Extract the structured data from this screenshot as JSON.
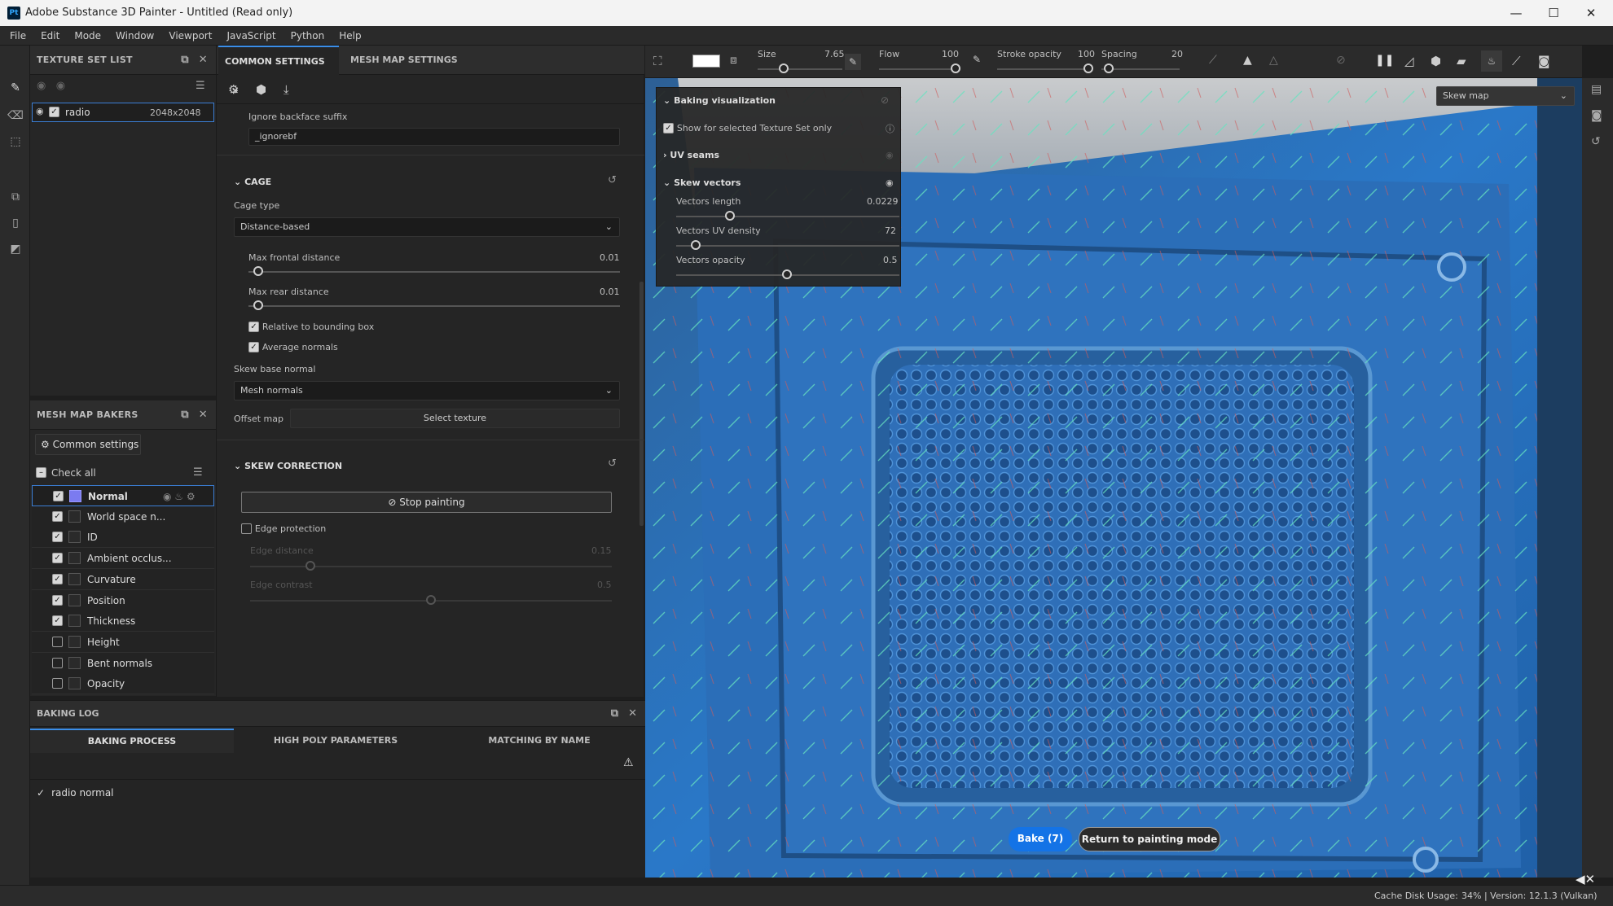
{
  "window": {
    "app_icon": "Pt",
    "title": "Adobe Substance 3D Painter - Untitled (Read only)",
    "minimize": "—",
    "maximize": "☐",
    "close": "✕"
  },
  "menu": [
    "File",
    "Edit",
    "Mode",
    "Window",
    "Viewport",
    "JavaScript",
    "Python",
    "Help"
  ],
  "texture_set_list": {
    "title": "TEXTURE SET LIST",
    "item": {
      "name": "radio",
      "resolution": "2048x2048",
      "checked": true
    }
  },
  "mesh_map_bakers": {
    "title": "MESH MAP BAKERS",
    "common_settings": "Common settings",
    "check_all": "Check all",
    "items": [
      {
        "label": "Normal",
        "checked": true,
        "selected": true
      },
      {
        "label": "World space n...",
        "checked": true
      },
      {
        "label": "ID",
        "checked": true
      },
      {
        "label": "Ambient occlus...",
        "checked": true
      },
      {
        "label": "Curvature",
        "checked": true
      },
      {
        "label": "Position",
        "checked": true
      },
      {
        "label": "Thickness",
        "checked": true
      },
      {
        "label": "Height",
        "checked": false
      },
      {
        "label": "Bent normals",
        "checked": false
      },
      {
        "label": "Opacity",
        "checked": false
      }
    ]
  },
  "settings": {
    "tab_common": "COMMON SETTINGS",
    "tab_mesh": "MESH MAP SETTINGS",
    "ignore_backface_label": "Ignore backface suffix",
    "ignore_backface_value": "_ignorebf",
    "cage_title": "CAGE",
    "cage_type_label": "Cage type",
    "cage_type_value": "Distance-based",
    "max_frontal_label": "Max frontal distance",
    "max_frontal_value": "0.01",
    "max_rear_label": "Max rear distance",
    "max_rear_value": "0.01",
    "relative_bbox": "Relative to bounding box",
    "average_normals": "Average normals",
    "skew_base_label": "Skew base normal",
    "skew_base_value": "Mesh normals",
    "offset_map_label": "Offset map",
    "select_texture": "Select texture",
    "skew_title": "SKEW CORRECTION",
    "stop_painting": "Stop painting",
    "edge_protection": "Edge protection",
    "edge_distance_label": "Edge distance",
    "edge_distance_value": "0.15",
    "edge_contrast_label": "Edge contrast",
    "edge_contrast_value": "0.5"
  },
  "toolbar": {
    "size_label": "Size",
    "size_value": "7.65",
    "flow_label": "Flow",
    "flow_value": "100",
    "stroke_label": "Stroke opacity",
    "stroke_value": "100",
    "spacing_label": "Spacing",
    "spacing_value": "20"
  },
  "viewport": {
    "mode_select": "Skew map",
    "bake_button": "Bake (7)",
    "return_button": "Return to painting mode"
  },
  "viz_panel": {
    "title": "Baking visualization",
    "show_selected": "Show for selected Texture Set only",
    "uv_seams": "UV seams",
    "skew_vectors": "Skew vectors",
    "vectors_length_label": "Vectors length",
    "vectors_length_value": "0.0229",
    "vectors_uv_label": "Vectors UV density",
    "vectors_uv_value": "72",
    "vectors_opacity_label": "Vectors opacity",
    "vectors_opacity_value": "0.5"
  },
  "baking_log": {
    "title": "BAKING LOG",
    "tab_process": "BAKING PROCESS",
    "tab_high_poly": "HIGH POLY PARAMETERS",
    "tab_matching": "MATCHING BY NAME",
    "entry": "radio normal"
  },
  "status": {
    "cache": "Cache Disk Usage:",
    "cache_value": "34% | Version: 12.1.3 (Vulkan)"
  }
}
